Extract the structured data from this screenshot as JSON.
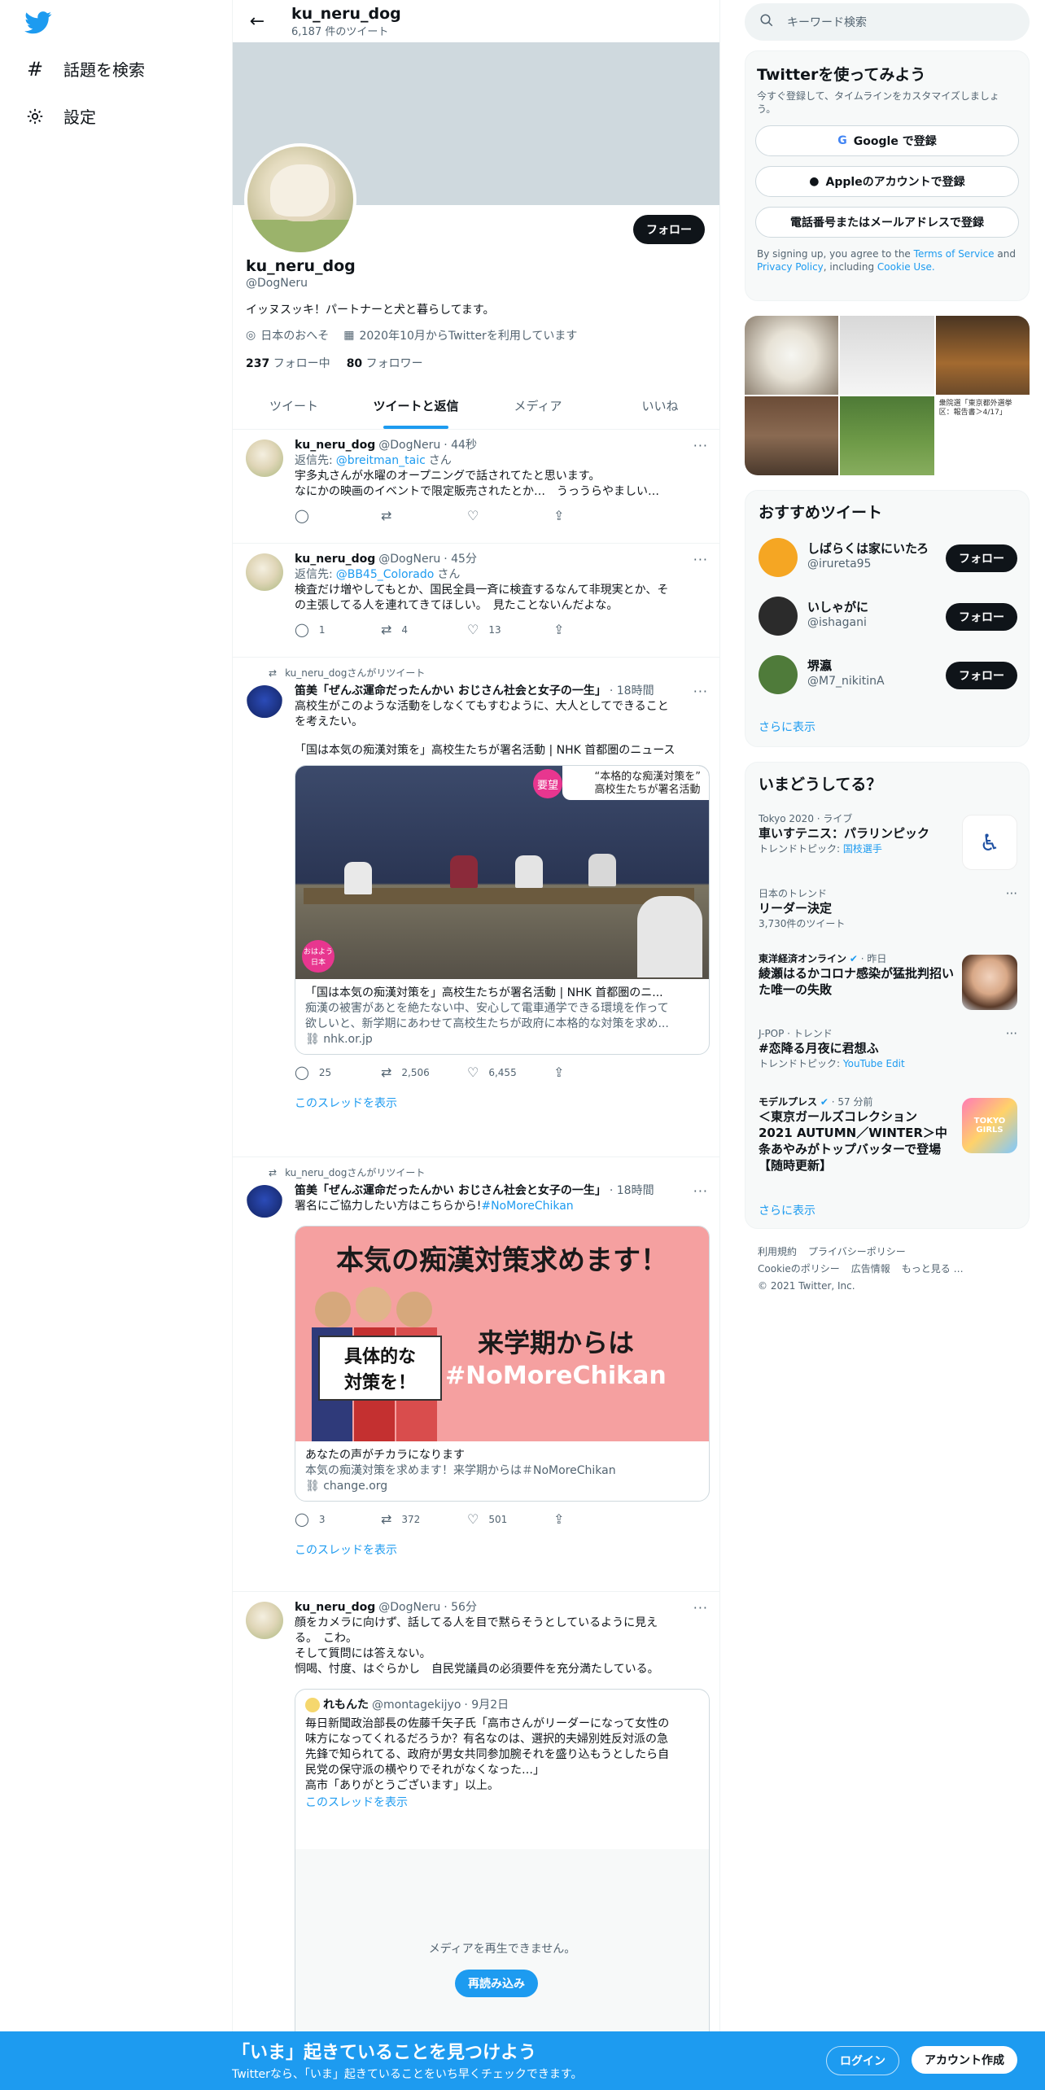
{
  "nav": {
    "items": [
      {
        "icon": "hashtag-icon",
        "label": "話題を検索"
      },
      {
        "icon": "gear-icon",
        "label": "設定"
      }
    ]
  },
  "header": {
    "name": "ku_neru_dog",
    "tweet_count": "6,187 件のツイート"
  },
  "profile": {
    "name": "ku_neru_dog",
    "handle": "@DogNeru",
    "bio": "イッヌスッキ！パートナーと犬と暮らしてます。",
    "location": "日本のおへそ",
    "joined": "2020年10月からTwitterを利用しています",
    "following_count": "237",
    "following_label": "フォロー中",
    "followers_count": "80",
    "followers_label": "フォロワー",
    "follow_button": "フォロー"
  },
  "tabs": [
    "ツイート",
    "ツイートと返信",
    "メディア",
    "いいね"
  ],
  "tweets": [
    {
      "name": "ku_neru_dog",
      "handle": "@DogNeru",
      "time": "· 44秒",
      "reply_prefix": "返信先:",
      "reply_to": "@breitman_taic",
      "reply_suffix": "さん",
      "text1": "宇多丸さんが水曜のオープニングで話されてたと思います。",
      "text2": "なにかの映画のイベントで限定販売されたとか…　うっうらやましい…"
    },
    {
      "name": "ku_neru_dog",
      "handle": "@DogNeru",
      "time": "· 45分",
      "reply_prefix": "返信先:",
      "reply_to": "@BB45_Colorado",
      "reply_suffix": "さん",
      "text1": "検査だけ増やしてもとか、国民全員一斉に検査するなんて非現実とか、そ",
      "text2": "の主張してる人を連れてきてほしい。　見たことないんだよな。",
      "replies": "1",
      "retweets": "4",
      "likes": "13"
    },
    {
      "rt_label": "ku_neru_dogさんがリツイート",
      "name": "笛美「ぜんぶ運命だったんかい おじさん社会と女子の一生」",
      "time": "· 18時間",
      "text1": "高校生がこのような活動をしなくてもすむように、大人としてできること",
      "text2": "を考えたい。",
      "text3": "「国は本気の痴漢対策を」高校生たちが署名活動 | NHK 首都圏のニュース",
      "card_overlay_badge": "要望",
      "card_overlay_text1": "“本格的な痴漢対策を”",
      "card_overlay_text2": "高校生たちが署名活動",
      "card_corner": "おはよう日本",
      "card_title": "「国は本気の痴漢対策を」高校生たちが署名活動 | NHK 首都圏のニ...",
      "card_desc1": "痴漢の被害があとを絶たない中、安心して電車通学できる環境を作って",
      "card_desc2": "欲しいと、新学期にあわせて高校生たちが政府に本格的な対策を求め...",
      "card_domain": "nhk.or.jp",
      "replies": "25",
      "retweets": "2,506",
      "likes": "6,455",
      "show_thread": "このスレッドを表示"
    },
    {
      "rt_label": "ku_neru_dogさんがリツイート",
      "name": "笛美「ぜんぶ運命だったんかい おじさん社会と女子の一生」",
      "time": "· 18時間",
      "text1": "署名にご協力したい方はこちらから!",
      "hashtag": "#NoMoreChikan",
      "poster_title": "本気の痴漢対策求めます！",
      "poster_sign1": "具体的な",
      "poster_sign2": "対策を！",
      "poster_right1": "来学期からは",
      "poster_right2": "#NoMoreChikan",
      "card_title": "あなたの声がチカラになります",
      "card_desc1": "本気の痴漢対策を求めます！来学期からは＃NoMoreChikan",
      "card_domain": "change.org",
      "replies": "3",
      "retweets": "372",
      "likes": "501",
      "show_thread": "このスレッドを表示"
    },
    {
      "name": "ku_neru_dog",
      "handle": "@DogNeru",
      "time": "· 56分",
      "text1": "顔をカメラに向けず、話してる人を目で黙らそうとしているように見え",
      "text2": "る。　こわ。",
      "text3": "そして質問には答えない。",
      "text4": "恫喝、忖度、はぐらかし　自民党議員の必須要件を充分満たしている。",
      "quote_name": "れもんた",
      "quote_handle": "@montagekijyo",
      "quote_time": "· 9月2日",
      "quote_text1": "毎日新聞政治部長の佐藤千矢子氏「高市さんがリーダーになって女性の",
      "quote_text2": "味方になってくれるだろうか？有名なのは、選択的夫婦別姓反対派の急",
      "quote_text3": "先鋒で知られてる、政府が男女共同参加腕それを盛り込もうとしたら自",
      "quote_text4": "民党の保守派の横やりでそれがなくなった…」",
      "quote_text5": "高市「ありがとうございます」以上。",
      "show_thread": "このスレッドを表示",
      "media_error": "メディアを再生できません。",
      "reload": "再読み込み"
    }
  ],
  "right": {
    "search_placeholder": "キーワード検索",
    "signup": {
      "title": "Twitterを使ってみよう",
      "subtitle": "今すぐ登録して、タイムラインをカスタマイズしましょう。",
      "google": "Google で登録",
      "apple": "Appleのアカウントで登録",
      "phone": "電話番号またはメールアドレスで登録",
      "terms_pre": "By signing up, you agree to the",
      "terms": "Terms of Service",
      "and": "and",
      "privacy": "Privacy Policy",
      "including": ", including",
      "cookie": "Cookie Use."
    },
    "photo_caption": "衆院選「東京都外選挙区：報告書＞4/17」",
    "recommended": {
      "title": "おすすめツイート",
      "items": [
        {
          "name": "しばらくは家にいたろ",
          "handle": "@irureta95",
          "button": "フォロー",
          "color": "#f5a623"
        },
        {
          "name": "いしゃがに",
          "handle": "@ishagani",
          "button": "フォロー",
          "color": "#2b2b2b"
        },
        {
          "name": "堺瀛",
          "handle": "@M7_nikitinA",
          "button": "フォロー",
          "color": "#4f7b3a"
        }
      ],
      "more": "さらに表示"
    },
    "trends": {
      "title": "いまどうしてる？",
      "items": [
        {
          "meta": "Tokyo 2020 · ライブ",
          "title": "車いすテニス：パラリンピック",
          "sub_pre": "トレンドトピック:",
          "sub_link": "国枝選手"
        },
        {
          "meta": "日本のトレンド",
          "title": "リーダー決定",
          "sub_pre": "3,730件のツイート",
          "sub_link": ""
        },
        {
          "meta_source": "東洋経済オンライン",
          "meta_time": "· 昨日",
          "title": "綾瀬はるかコロナ感染が猛批判招いた唯一の失敗"
        },
        {
          "meta": "J-POP · トレンド",
          "title": "#恋降る月夜に君想ふ",
          "sub_pre": "トレンドトピック:",
          "sub_link": "YouTube Edit"
        },
        {
          "meta_source": "モデルプレス",
          "meta_time": "· 57 分前",
          "title": "＜東京ガールズコレクション 2021 AUTUMN／WINTER＞中条あやみがトップバッターで登場【随時更新】",
          "image_text": "TOKYO GIRLS"
        }
      ],
      "more": "さらに表示"
    },
    "footer": {
      "links1": [
        "利用規約",
        "プライバシーポリシー"
      ],
      "links2": [
        "Cookieのポリシー",
        "広告情報",
        "もっと見る …"
      ],
      "copyright": "© 2021 Twitter, Inc."
    }
  },
  "bottom": {
    "title": "「いま」起きていることを見つけよう",
    "subtitle": "Twitterなら、「いま」起きていることをいち早くチェックできます。",
    "login": "ログイン",
    "signup": "アカウント作成"
  },
  "colors": {
    "accent": "#1d9bf0",
    "text": "#0f1419",
    "muted": "#536471",
    "border": "#eff3f4"
  }
}
